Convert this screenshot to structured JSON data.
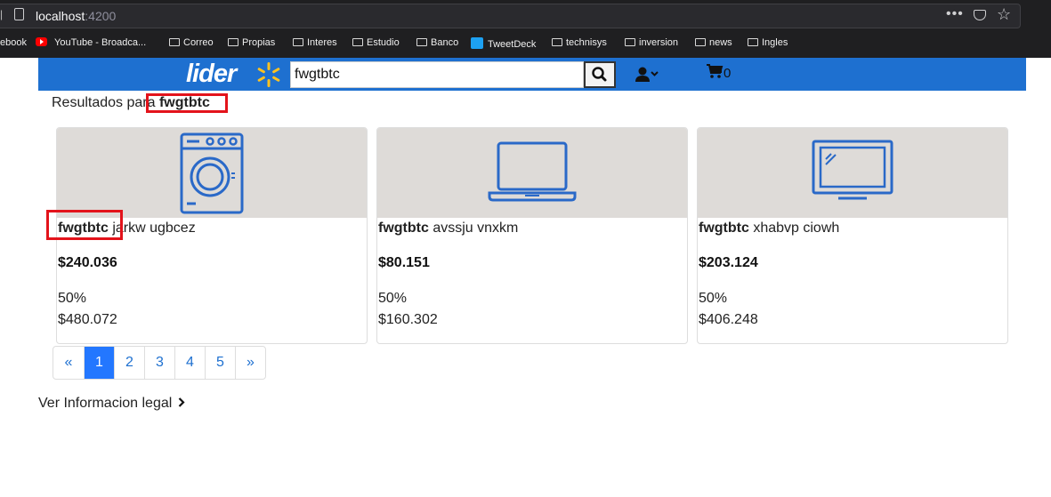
{
  "browser": {
    "url_host": "localhost",
    "url_port": ":4200",
    "bookmarks": [
      {
        "label": "ebook",
        "icon": "none"
      },
      {
        "label": "YouTube - Broadca...",
        "icon": "youtube-icon"
      },
      {
        "label": "Correo",
        "icon": "folder-icon"
      },
      {
        "label": "Propias",
        "icon": "folder-icon"
      },
      {
        "label": "Interes",
        "icon": "folder-icon"
      },
      {
        "label": "Estudio",
        "icon": "folder-icon"
      },
      {
        "label": "Banco",
        "icon": "folder-icon"
      },
      {
        "label": "TweetDeck",
        "icon": "twitter-icon"
      },
      {
        "label": "technisys",
        "icon": "folder-icon"
      },
      {
        "label": "inversion",
        "icon": "folder-icon"
      },
      {
        "label": "news",
        "icon": "folder-icon"
      },
      {
        "label": "Ingles",
        "icon": "folder-icon"
      }
    ]
  },
  "header": {
    "logo_text": "lider",
    "search_value": "fwgtbtc",
    "cart_count": "0",
    "brand_color": "#1e70d0",
    "spark_color": "#ffc220"
  },
  "results": {
    "prefix": "Resultados para",
    "query": "fwgtbtc"
  },
  "products": [
    {
      "icon": "washing-machine-icon",
      "title_bold": "fwgtbtc",
      "title_rest": "jarkw ugbcez",
      "price": "$240.036",
      "discount": "50%",
      "old_price": "$480.072"
    },
    {
      "icon": "laptop-icon",
      "title_bold": "fwgtbtc",
      "title_rest": "avssju vnxkm",
      "price": "$80.151",
      "discount": "50%",
      "old_price": "$160.302"
    },
    {
      "icon": "tv-icon",
      "title_bold": "fwgtbtc",
      "title_rest": "xhabvp ciowh",
      "price": "$203.124",
      "discount": "50%",
      "old_price": "$406.248"
    }
  ],
  "pagination": {
    "prev": "«",
    "pages": [
      "1",
      "2",
      "3",
      "4",
      "5"
    ],
    "next": "»",
    "active": "1"
  },
  "footer": {
    "legal_link": "Ver Informacion legal"
  },
  "highlight_color": "#e3131b"
}
